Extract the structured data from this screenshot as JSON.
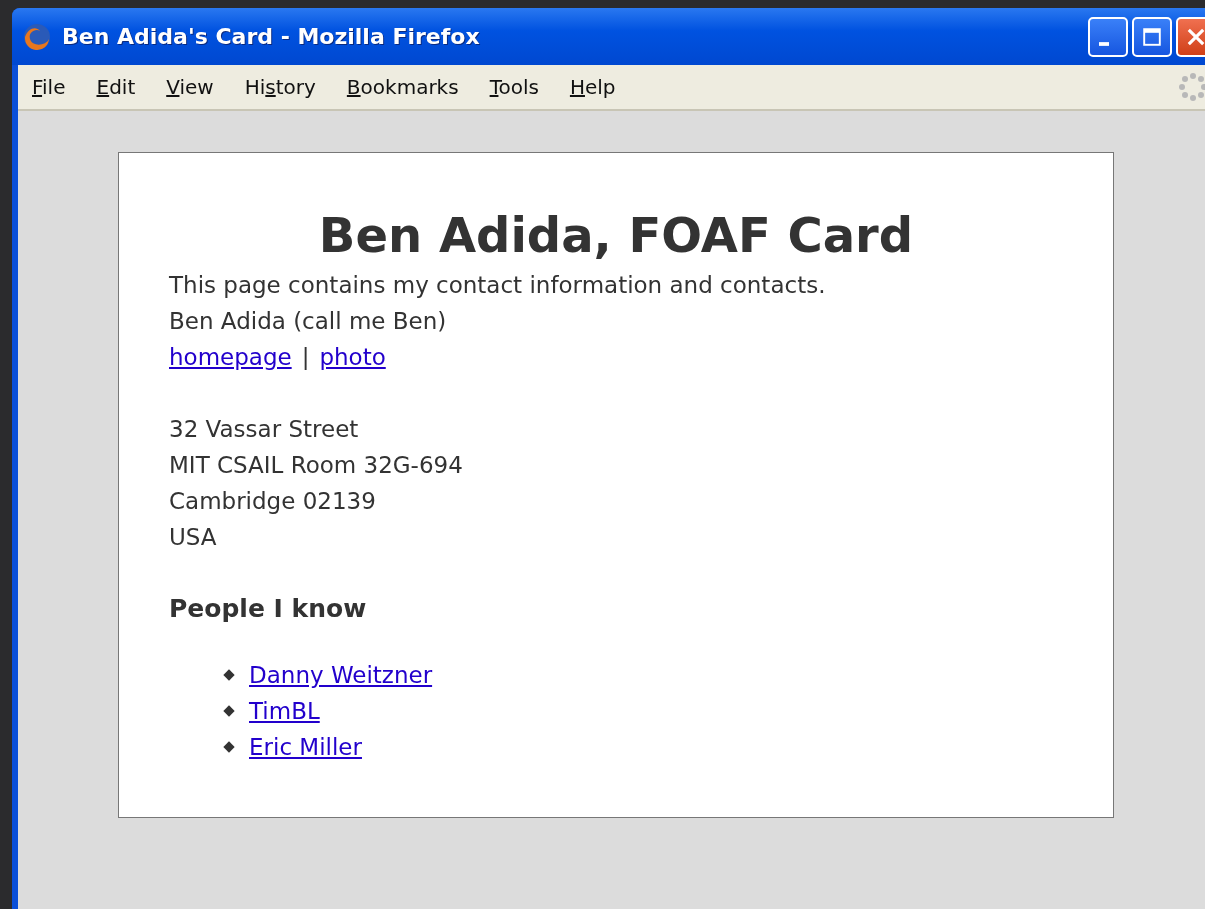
{
  "window": {
    "title": "Ben Adida's Card - Mozilla Firefox"
  },
  "menu": [
    {
      "key": "F",
      "post": "ile"
    },
    {
      "key": "E",
      "post": "dit"
    },
    {
      "key": "V",
      "post": "iew"
    },
    {
      "pre": "Hi",
      "key": "s",
      "post": "tory"
    },
    {
      "key": "B",
      "post": "ookmarks"
    },
    {
      "key": "T",
      "post": "ools"
    },
    {
      "key": "H",
      "post": "elp"
    }
  ],
  "card": {
    "heading": "Ben Adida, FOAF Card",
    "intro": "This page contains my contact information and contacts.",
    "name_line": "Ben Adida (call me Ben)",
    "links": [
      "homepage",
      "photo"
    ],
    "separator": "|",
    "address": [
      "32 Vassar Street",
      "MIT CSAIL Room 32G-694",
      "Cambridge 02139",
      "USA"
    ],
    "people_heading": "People I know",
    "people": [
      "Danny Weitzner",
      "TimBL",
      "Eric Miller"
    ]
  }
}
